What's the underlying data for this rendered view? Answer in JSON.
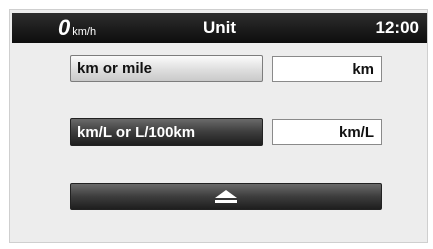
{
  "status": {
    "speed_value": "0",
    "speed_unit": "km/h",
    "title": "Unit",
    "clock": "12:00"
  },
  "settings": [
    {
      "label": "km or mile",
      "value": "km"
    },
    {
      "label": "km/L or L/100km",
      "value": "km/L"
    }
  ],
  "up_button": {
    "icon": "eject-up-icon"
  }
}
